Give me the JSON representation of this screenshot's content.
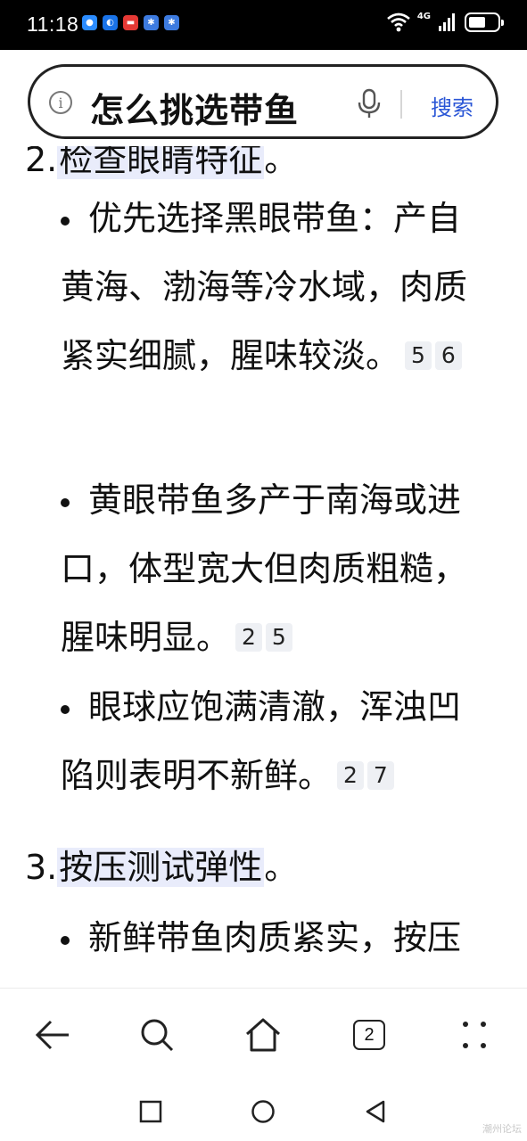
{
  "status_bar": {
    "time": "11:18",
    "network": "4G",
    "battery_level": 0.6,
    "app_icons": [
      "chat-app-icon",
      "lightbulb-app-icon",
      "mail-app-icon",
      "gear-app-icon",
      "gear-app-icon"
    ]
  },
  "search": {
    "query": "怎么挑选带鱼",
    "button_label": "搜索"
  },
  "article": {
    "item2": {
      "number": "2.",
      "title": "检查眼睛特征",
      "suffix": "。"
    },
    "item2_bullets": [
      {
        "text": "优先选择黑眼带鱼：产自黄海、渤海等冷水域，肉质紧实细腻，腥味较淡。",
        "refs": [
          "5",
          "6"
        ]
      },
      {
        "text": "黄眼带鱼多产于南海或进口，体型宽大但肉质粗糙，腥味明显。",
        "refs": [
          "2",
          "5"
        ]
      },
      {
        "text": "眼球应饱满清澈，浑浊凹陷则表明不新鲜。",
        "refs": [
          "2",
          "7"
        ]
      }
    ],
    "item3": {
      "number": "3.",
      "title": "按压测试弹性",
      "suffix": "。"
    },
    "item3_bullets": [
      {
        "text": "新鲜带鱼肉质紧实，按压后能迅速回弹。",
        "refs": []
      }
    ]
  },
  "browser_bar": {
    "tab_count": "2"
  },
  "watermark": "潮州论坛"
}
